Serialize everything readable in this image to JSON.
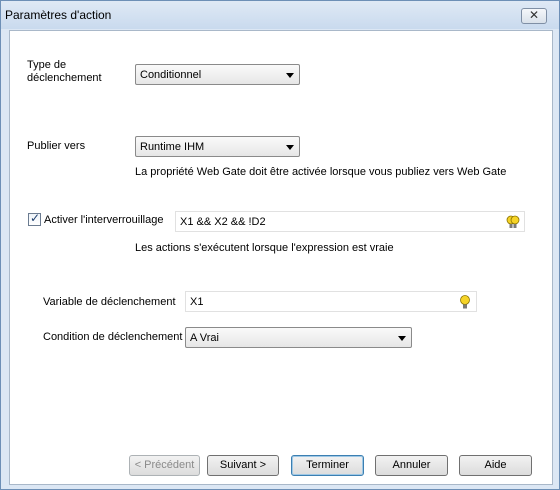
{
  "window": {
    "title": "Paramètres d'action",
    "close_label": "✕"
  },
  "trigger_type": {
    "label": "Type de\ndéclenchement",
    "value": "Conditionnel"
  },
  "publish": {
    "label": "Publier vers",
    "value": "Runtime IHM",
    "note": "La propriété Web Gate doit être activée lorsque vous publiez vers Web Gate"
  },
  "interlock": {
    "checked": true,
    "label": "Activer l'interverrouillage",
    "expression": "X1 && X2 && !D2",
    "note": "Les actions s'exécutent lorsque l'expression est vraie"
  },
  "trigger_variable": {
    "label": "Variable de déclenchement",
    "value": "X1"
  },
  "trigger_condition": {
    "label": "Condition de déclenchement",
    "value": "A Vrai"
  },
  "buttons": {
    "previous": "< Précédent",
    "next": "Suivant >",
    "finish": "Terminer",
    "cancel": "Annuler",
    "help": "Aide"
  },
  "icons": {
    "check": "✓",
    "bulb_color": "#f5d327"
  }
}
